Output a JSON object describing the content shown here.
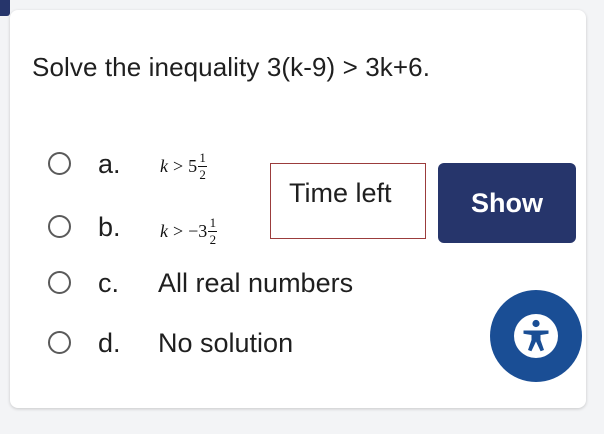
{
  "question": {
    "prefix": "Solve the inequality ",
    "expression": "3(k-9) > 3k+6."
  },
  "options": [
    {
      "letter": "a.",
      "var": "k",
      "op": ">",
      "whole": "5",
      "numerator": "1",
      "denominator": "2"
    },
    {
      "letter": "b.",
      "var": "k",
      "op": ">",
      "whole": "−3",
      "numerator": "1",
      "denominator": "2"
    },
    {
      "letter": "c.",
      "text": "All real numbers"
    },
    {
      "letter": "d.",
      "text": "No solution"
    }
  ],
  "timer": {
    "label": "Time left"
  },
  "show_button": {
    "label": "Show"
  },
  "accessibility": {
    "icon": "accessibility-icon"
  },
  "colors": {
    "accent": "#26356b",
    "access": "#1a4e95",
    "timer_border": "#9b3c3c"
  }
}
